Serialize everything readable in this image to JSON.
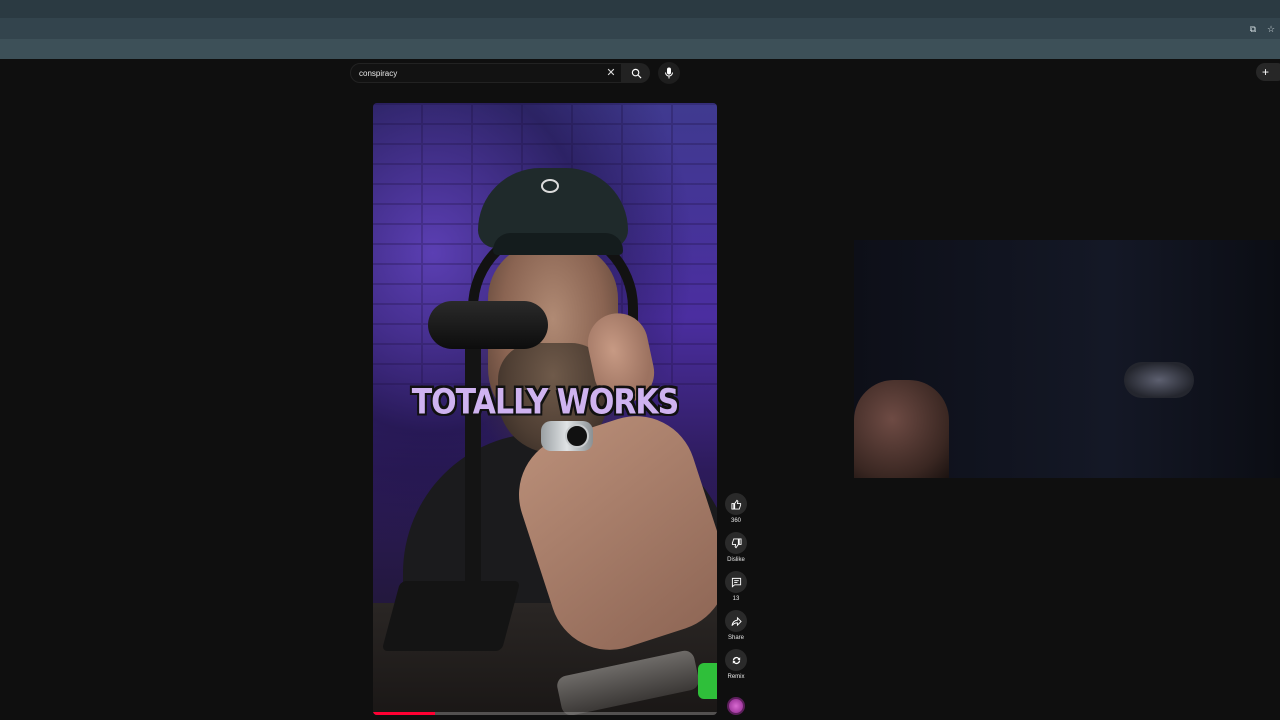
{
  "search": {
    "query": "conspiracy",
    "clear_icon": "close-icon",
    "search_icon": "search-icon",
    "mic_icon": "mic-icon"
  },
  "create_button": {
    "icon": "plus-icon",
    "label": "+"
  },
  "short": {
    "caption": "TOTALLY WORKS",
    "progress_percent": 18
  },
  "actions": {
    "like": {
      "icon": "thumbs-up-icon",
      "label": "360"
    },
    "dislike": {
      "icon": "thumbs-down-icon",
      "label": "Dislike"
    },
    "comments": {
      "icon": "comment-icon",
      "label": "13"
    },
    "share": {
      "icon": "share-icon",
      "label": "Share"
    },
    "remix": {
      "icon": "remix-icon",
      "label": "Remix"
    }
  },
  "colors": {
    "background": "#0f0f0f",
    "caption_text": "#cfb3f0",
    "progress_red": "#ff0033"
  }
}
